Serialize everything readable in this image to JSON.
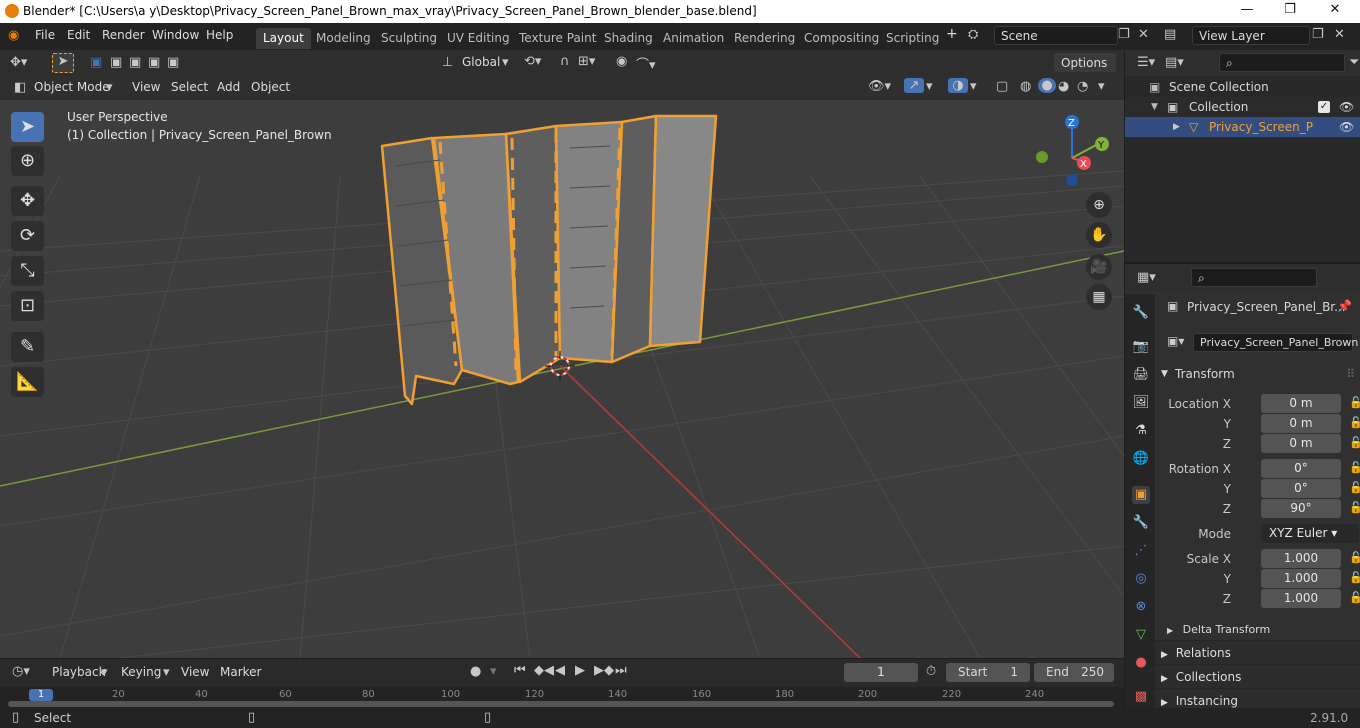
{
  "window": {
    "title": "Blender* [C:\\Users\\a y\\Desktop\\Privacy_Screen_Panel_Brown_max_vray\\Privacy_Screen_Panel_Brown_blender_base.blend]",
    "minimize": "—",
    "maximize": "❐",
    "close": "✕"
  },
  "menubar": {
    "items": [
      "File",
      "Edit",
      "Render",
      "Window",
      "Help"
    ]
  },
  "workspaces": {
    "tabs": [
      "Layout",
      "Modeling",
      "Sculpting",
      "UV Editing",
      "Texture Paint",
      "Shading",
      "Animation",
      "Rendering",
      "Compositing",
      "Scripting"
    ],
    "active": "Layout",
    "add": "+"
  },
  "scene": {
    "label": "Scene",
    "view_layer": "View Layer"
  },
  "tool_header": {
    "orientation": "Global",
    "options": "Options"
  },
  "viewport_header": {
    "mode": "Object Mode",
    "menus": [
      "View",
      "Select",
      "Add",
      "Object"
    ]
  },
  "viewport": {
    "perspective": "User Perspective",
    "collection_info": "(1) Collection | Privacy_Screen_Panel_Brown",
    "gizmo": {
      "x": "X",
      "y": "Y",
      "z": "Z"
    }
  },
  "outliner": {
    "scene_collection": "Scene Collection",
    "collection": "Collection",
    "object": "Privacy_Screen_Pane"
  },
  "properties": {
    "object_name_header": "Privacy_Screen_Panel_Br...",
    "object_name_field": "Privacy_Screen_Panel_Brown",
    "transform_label": "Transform",
    "location_label": "Location X",
    "rotation_label": "Rotation X",
    "scale_label": "Scale X",
    "axis_y": "Y",
    "axis_z": "Z",
    "location": {
      "x": "0 m",
      "y": "0 m",
      "z": "0 m"
    },
    "rotation": {
      "x": "0°",
      "y": "0°",
      "z": "90°"
    },
    "mode_label": "Mode",
    "mode_value": "XYZ Euler",
    "scale": {
      "x": "1.000",
      "y": "1.000",
      "z": "1.000"
    },
    "delta_transform": "Delta Transform",
    "sections": [
      "Relations",
      "Collections",
      "Instancing"
    ]
  },
  "timeline": {
    "menus": [
      "Playback",
      "Keying",
      "View",
      "Marker"
    ],
    "current_frame": "1",
    "start_label": "Start",
    "start": "1",
    "end_label": "End",
    "end": "250",
    "ruler": [
      "1",
      "20",
      "40",
      "60",
      "80",
      "100",
      "120",
      "140",
      "160",
      "180",
      "200",
      "220",
      "240"
    ]
  },
  "statusbar": {
    "left": "Select",
    "version": "2.91.0"
  },
  "colors": {
    "selection": "#f0a032",
    "active_tab": "#4772b3",
    "x_axis": "#e84b5a",
    "y_axis": "#7fb33a",
    "z_axis": "#2c75d6"
  }
}
